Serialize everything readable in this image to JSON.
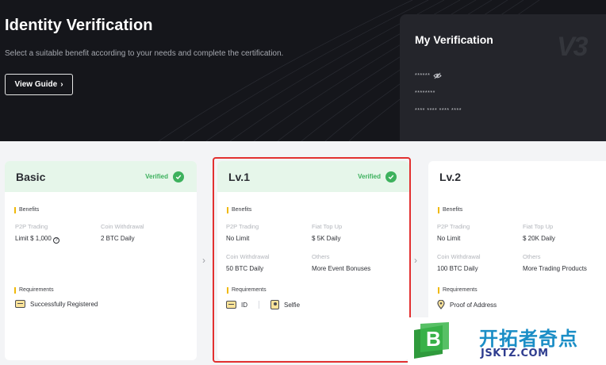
{
  "hero": {
    "title": "Identity Verification",
    "subtitle": "Select a suitable benefit according to your needs and complete the certification.",
    "guide_button": "View Guide",
    "my_verification": {
      "title": "My Verification",
      "row1": "******",
      "row2": "********",
      "row3": "**** **** **** ****"
    }
  },
  "cards": {
    "basic": {
      "title": "Basic",
      "status": "Verified",
      "benefits_label": "Benefits",
      "b1_key": "P2P Trading",
      "b1_val": "Limit $ 1,000",
      "b2_key": "Coin Withdrawal",
      "b2_val": "2 BTC Daily",
      "requirements_label": "Requirements",
      "req1": "Successfully Registered"
    },
    "lv1": {
      "title": "Lv.1",
      "status": "Verified",
      "benefits_label": "Benefits",
      "b1_key": "P2P Trading",
      "b1_val": "No Limit",
      "b2_key": "Fiat Top Up",
      "b2_val": "$ 5K Daily",
      "b3_key": "Coin Withdrawal",
      "b3_val": "50 BTC Daily",
      "b4_key": "Others",
      "b4_val": "More Event Bonuses",
      "requirements_label": "Requirements",
      "req1": "ID",
      "req2": "Selfie"
    },
    "lv2": {
      "title": "Lv.2",
      "benefits_label": "Benefits",
      "b1_key": "P2P Trading",
      "b1_val": "No Limit",
      "b2_key": "Fiat Top Up",
      "b2_val": "$ 20K Daily",
      "b3_key": "Coin Withdrawal",
      "b3_val": "100 BTC Daily",
      "b4_key": "Others",
      "b4_val": "More Trading Products",
      "requirements_label": "Requirements",
      "req1": "Proof of Address"
    }
  },
  "watermark": {
    "cn": "开拓者奇点",
    "en": "JSKTZ.COM"
  },
  "colors": {
    "hero_bg": "#15161b",
    "verified_green": "#3db15d",
    "verified_bg": "#e6f6ea",
    "accent_yellow": "#f0b90b",
    "highlight_red": "#e23030"
  }
}
